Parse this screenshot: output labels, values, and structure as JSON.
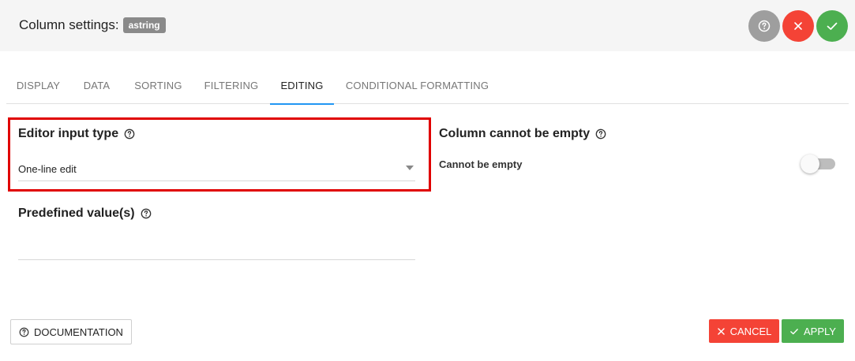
{
  "header": {
    "title": "Column settings:",
    "column_badge": "astring"
  },
  "tabs": [
    {
      "label": "DISPLAY"
    },
    {
      "label": "DATA"
    },
    {
      "label": "SORTING"
    },
    {
      "label": "FILTERING"
    },
    {
      "label": "EDITING"
    },
    {
      "label": "CONDITIONAL FORMATTING"
    }
  ],
  "active_tab": "EDITING",
  "editor": {
    "label": "Editor input type",
    "selected_value": "One-line edit"
  },
  "predefined": {
    "label": "Predefined value(s)",
    "value": ""
  },
  "not_empty": {
    "label": "Column cannot be empty",
    "toggle_label": "Cannot be empty",
    "enabled": false
  },
  "footer": {
    "documentation": "DOCUMENTATION",
    "cancel": "CANCEL",
    "apply": "APPLY"
  },
  "colors": {
    "help": "#9e9e9e",
    "close": "#f44336",
    "confirm": "#4caf50",
    "active_tab": "#2196f3",
    "highlight": "#e00000"
  },
  "icons": {
    "help": "help-circle-icon",
    "close": "close-icon",
    "confirm": "check-icon",
    "dropdown": "caret-down-icon"
  }
}
